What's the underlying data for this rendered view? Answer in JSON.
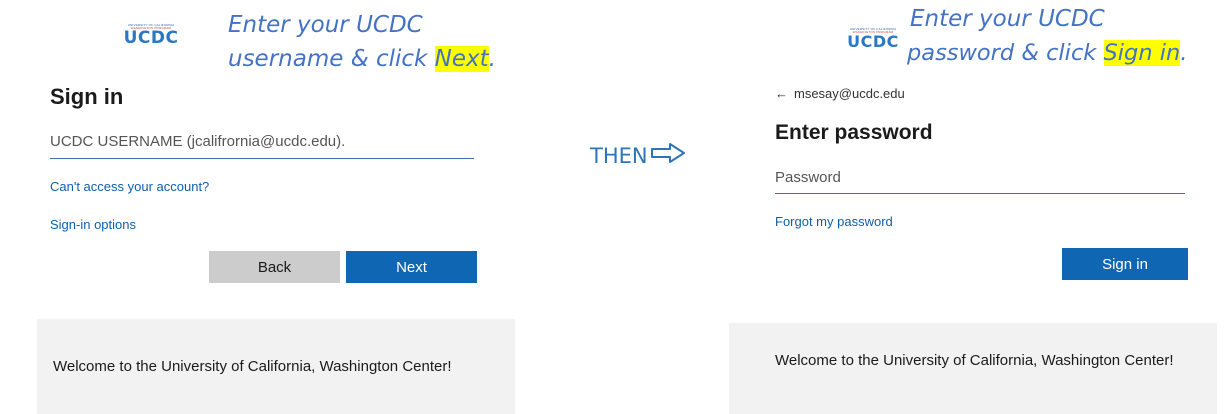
{
  "left": {
    "logo": {
      "small_line1": "UNIVERSITY OF CALIFORNIA",
      "small_line2": "WASHINGTON PROGRAM",
      "text": "UCDC"
    },
    "instruction": {
      "line1": "Enter your UCDC",
      "line2_pre": "username & click ",
      "line2_highlight": "Next",
      "line2_post": "."
    },
    "title": "Sign in",
    "username_placeholder": "UCDC USERNAME (jcalifrornia@ucdc.edu).",
    "cant_access_link": "Can't access your account?",
    "signin_options_link": "Sign-in options",
    "back_button": "Back",
    "next_button": "Next",
    "welcome": "Welcome to the University of California, Washington Center!"
  },
  "middle": {
    "then_label": "THEN",
    "arrow_icon": "right-arrow-outline-icon"
  },
  "right": {
    "logo": {
      "small_line1": "UNIVERSITY OF CALIFORNIA",
      "small_line2": "WASHINGTON PROGRAM",
      "text": "UCDC"
    },
    "instruction": {
      "line1": "Enter your UCDC",
      "line2_pre": "password & click ",
      "line2_highlight": "Sign in",
      "line2_post": "."
    },
    "back_arrow": "←",
    "account_email": "msesay@ucdc.edu",
    "title": "Enter password",
    "password_placeholder": "Password",
    "forgot_link": "Forgot my password",
    "signin_button": "Sign in",
    "welcome": "Welcome to the University of California, Washington Center!"
  },
  "colors": {
    "accent": "#0f67b4",
    "instruction": "#4472c4",
    "highlight": "#ffff00",
    "footer_bg": "#f2f2f2"
  }
}
